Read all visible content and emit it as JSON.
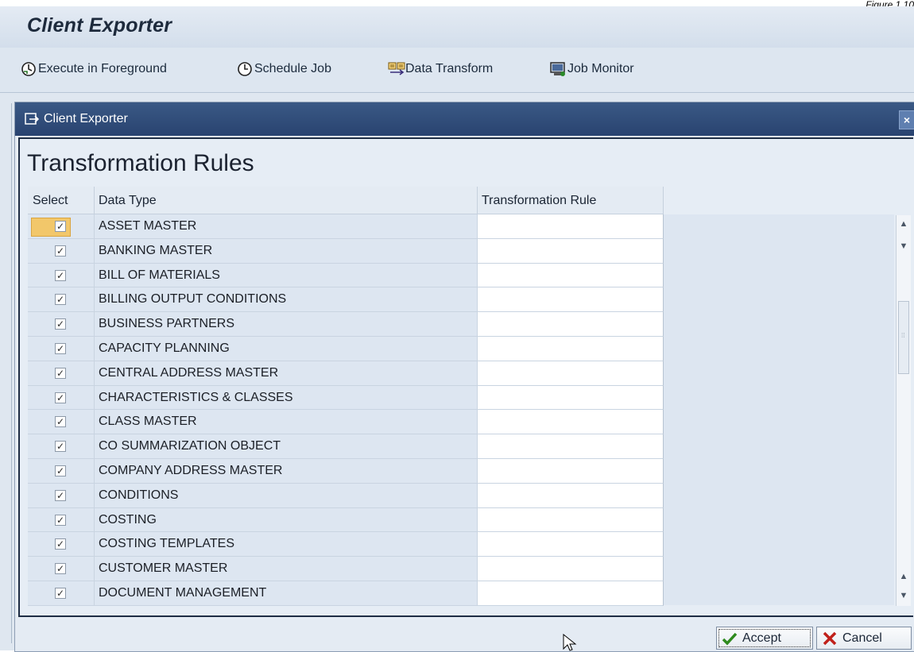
{
  "figure_label": "Figure 1.10",
  "app": {
    "title": "Client Exporter"
  },
  "toolbar": {
    "execute_foreground": "Execute in Foreground",
    "schedule_job": "Schedule Job",
    "data_transform": "Data Transform",
    "job_monitor": "Job Monitor"
  },
  "dialog": {
    "title": "Client Exporter",
    "close_label": "×",
    "section_title": "Transformation Rules",
    "columns": {
      "select": "Select",
      "data_type": "Data Type",
      "transformation_rule": "Transformation Rule"
    },
    "rows": [
      {
        "selected": true,
        "data_type": "ASSET MASTER",
        "rule": ""
      },
      {
        "selected": true,
        "data_type": "BANKING MASTER",
        "rule": ""
      },
      {
        "selected": true,
        "data_type": "BILL OF MATERIALS",
        "rule": ""
      },
      {
        "selected": true,
        "data_type": "BILLING OUTPUT CONDITIONS",
        "rule": ""
      },
      {
        "selected": true,
        "data_type": "BUSINESS PARTNERS",
        "rule": ""
      },
      {
        "selected": true,
        "data_type": "CAPACITY PLANNING",
        "rule": ""
      },
      {
        "selected": true,
        "data_type": "CENTRAL ADDRESS MASTER",
        "rule": ""
      },
      {
        "selected": true,
        "data_type": "CHARACTERISTICS & CLASSES",
        "rule": ""
      },
      {
        "selected": true,
        "data_type": "CLASS MASTER",
        "rule": ""
      },
      {
        "selected": true,
        "data_type": "CO SUMMARIZATION OBJECT",
        "rule": ""
      },
      {
        "selected": true,
        "data_type": "COMPANY ADDRESS MASTER",
        "rule": ""
      },
      {
        "selected": true,
        "data_type": "CONDITIONS",
        "rule": ""
      },
      {
        "selected": true,
        "data_type": "COSTING",
        "rule": ""
      },
      {
        "selected": true,
        "data_type": "COSTING TEMPLATES",
        "rule": ""
      },
      {
        "selected": true,
        "data_type": "CUSTOMER MASTER",
        "rule": ""
      },
      {
        "selected": true,
        "data_type": "DOCUMENT MANAGEMENT",
        "rule": ""
      }
    ],
    "buttons": {
      "accept": "Accept",
      "cancel": "Cancel"
    }
  },
  "colors": {
    "titlebar": "#294370",
    "row_background": "#dde6f1",
    "focus": "#f2c76a"
  }
}
